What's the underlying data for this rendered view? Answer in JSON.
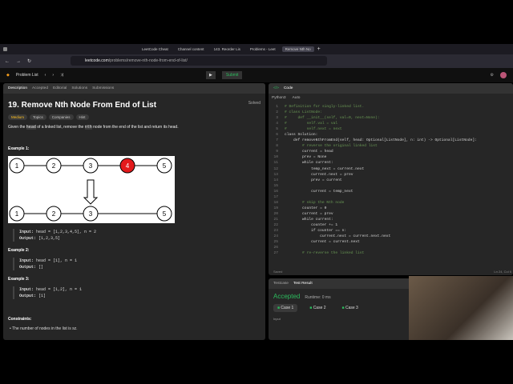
{
  "browser": {
    "tabs": [
      "LeetCode Cheat",
      "Channel content",
      "143. Reorder Lis",
      "Problems - Leet",
      "Remove Nth No"
    ],
    "url_domain": "leetcode.com",
    "url_path": "/problems/remove-nth-node-from-end-of-list/"
  },
  "header": {
    "problem_list": "Problem List",
    "submit": "Submit"
  },
  "left_tabs": [
    "Description",
    "Accepted",
    "Editorial",
    "Solutions",
    "Submissions"
  ],
  "problem": {
    "title": "19. Remove Nth Node From End of List",
    "solved": "Solved",
    "tags": [
      "Medium",
      "Topics",
      "Companies",
      "Hint"
    ],
    "desc_pre": "Given the ",
    "desc_code1": "head",
    "desc_mid": " of a linked list, remove the ",
    "desc_code2": "nth",
    "desc_post": " node from the end of the list and return its head.",
    "example1_title": "Example 1:",
    "diagram_top": [
      "1",
      "2",
      "3",
      "4",
      "5"
    ],
    "diagram_bottom": [
      "1",
      "2",
      "3",
      "5"
    ],
    "examples": [
      {
        "title": "Example 1:",
        "input": "head = [1,2,3,4,5], n = 2",
        "output": "[1,2,3,5]"
      },
      {
        "title": "Example 2:",
        "input": "head = [1], n = 1",
        "output": "[]"
      },
      {
        "title": "Example 3:",
        "input": "head = [1,2], n = 1",
        "output": "[1]"
      }
    ],
    "input_label": "Input:",
    "output_label": "Output:",
    "constraints_title": "Constraints:",
    "constraint1": "The number of nodes in the list is sz."
  },
  "code": {
    "title": "Code",
    "language": "Python3",
    "mode": "Auto",
    "saved": "Saved",
    "cursor": "Ln 24, Col 6",
    "lines": [
      "# Definition for singly-linked list.",
      "# class ListNode:",
      "#     def __init__(self, val=0, next=None):",
      "#         self.val = val",
      "#         self.next = next",
      "class Solution:",
      "    def removeNthFromEnd(self, head: Optional[ListNode], n: int) -> Optional[ListNode]:",
      "        # reverse the original linked list",
      "        current = head",
      "        prev = None",
      "        while current:",
      "            temp_next = current.next",
      "            current.next = prev",
      "            prev = current",
      "",
      "            current = temp_next",
      "",
      "        # skip the Nth node",
      "        counter = 0",
      "        current = prev",
      "        while current:",
      "            counter += 1",
      "            if counter == n:",
      "                current.next = current.next.next",
      "            current = current.next",
      "",
      "        # re-reverse the linked list"
    ]
  },
  "results": {
    "tab_testcase": "Testcase",
    "tab_result": "Test Result",
    "status": "Accepted",
    "runtime": "Runtime: 0 ms",
    "cases": [
      "Case 1",
      "Case 2",
      "Case 3"
    ],
    "input_label": "Input"
  }
}
